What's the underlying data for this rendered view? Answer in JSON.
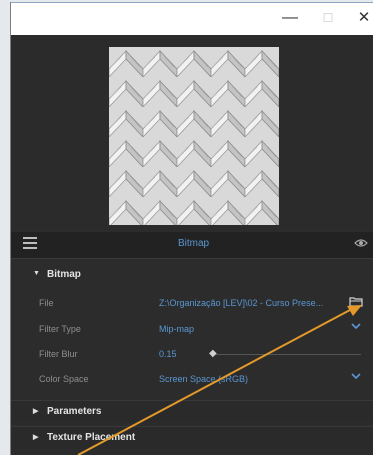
{
  "window": {
    "minimize_glyph": "—",
    "maximize_glyph": "☐",
    "close_glyph": "✕"
  },
  "header": {
    "title": "Bitmap"
  },
  "sections": {
    "bitmap": "Bitmap",
    "parameters": "Parameters",
    "texture_placement": "Texture Placement"
  },
  "properties": {
    "file": {
      "label": "File",
      "value": "Z:\\Organização [LEV]\\02 - Curso Prese..."
    },
    "filter_type": {
      "label": "Filter Type",
      "value": "Mip-map"
    },
    "filter_blur": {
      "label": "Filter Blur",
      "value": "0.15"
    },
    "color_space": {
      "label": "Color Space",
      "value": "Screen Space (sRGB)"
    }
  },
  "icons": {
    "menu": "hamburger-menu-icon",
    "visibility": "eye-icon",
    "folder": "folder-icon",
    "dropdown": "chevron-down-icon"
  },
  "colors": {
    "accent": "#5a97d3",
    "panel_bg": "#2c2c2c",
    "annotation_arrow": "#e39a2a"
  }
}
